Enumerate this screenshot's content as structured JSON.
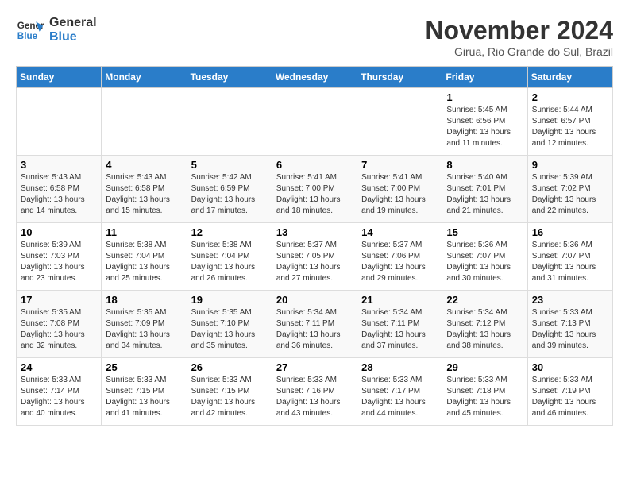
{
  "header": {
    "logo_line1": "General",
    "logo_line2": "Blue",
    "month": "November 2024",
    "location": "Girua, Rio Grande do Sul, Brazil"
  },
  "days_of_week": [
    "Sunday",
    "Monday",
    "Tuesday",
    "Wednesday",
    "Thursday",
    "Friday",
    "Saturday"
  ],
  "weeks": [
    [
      {
        "day": "",
        "info": ""
      },
      {
        "day": "",
        "info": ""
      },
      {
        "day": "",
        "info": ""
      },
      {
        "day": "",
        "info": ""
      },
      {
        "day": "",
        "info": ""
      },
      {
        "day": "1",
        "info": "Sunrise: 5:45 AM\nSunset: 6:56 PM\nDaylight: 13 hours and 11 minutes."
      },
      {
        "day": "2",
        "info": "Sunrise: 5:44 AM\nSunset: 6:57 PM\nDaylight: 13 hours and 12 minutes."
      }
    ],
    [
      {
        "day": "3",
        "info": "Sunrise: 5:43 AM\nSunset: 6:58 PM\nDaylight: 13 hours and 14 minutes."
      },
      {
        "day": "4",
        "info": "Sunrise: 5:43 AM\nSunset: 6:58 PM\nDaylight: 13 hours and 15 minutes."
      },
      {
        "day": "5",
        "info": "Sunrise: 5:42 AM\nSunset: 6:59 PM\nDaylight: 13 hours and 17 minutes."
      },
      {
        "day": "6",
        "info": "Sunrise: 5:41 AM\nSunset: 7:00 PM\nDaylight: 13 hours and 18 minutes."
      },
      {
        "day": "7",
        "info": "Sunrise: 5:41 AM\nSunset: 7:00 PM\nDaylight: 13 hours and 19 minutes."
      },
      {
        "day": "8",
        "info": "Sunrise: 5:40 AM\nSunset: 7:01 PM\nDaylight: 13 hours and 21 minutes."
      },
      {
        "day": "9",
        "info": "Sunrise: 5:39 AM\nSunset: 7:02 PM\nDaylight: 13 hours and 22 minutes."
      }
    ],
    [
      {
        "day": "10",
        "info": "Sunrise: 5:39 AM\nSunset: 7:03 PM\nDaylight: 13 hours and 23 minutes."
      },
      {
        "day": "11",
        "info": "Sunrise: 5:38 AM\nSunset: 7:04 PM\nDaylight: 13 hours and 25 minutes."
      },
      {
        "day": "12",
        "info": "Sunrise: 5:38 AM\nSunset: 7:04 PM\nDaylight: 13 hours and 26 minutes."
      },
      {
        "day": "13",
        "info": "Sunrise: 5:37 AM\nSunset: 7:05 PM\nDaylight: 13 hours and 27 minutes."
      },
      {
        "day": "14",
        "info": "Sunrise: 5:37 AM\nSunset: 7:06 PM\nDaylight: 13 hours and 29 minutes."
      },
      {
        "day": "15",
        "info": "Sunrise: 5:36 AM\nSunset: 7:07 PM\nDaylight: 13 hours and 30 minutes."
      },
      {
        "day": "16",
        "info": "Sunrise: 5:36 AM\nSunset: 7:07 PM\nDaylight: 13 hours and 31 minutes."
      }
    ],
    [
      {
        "day": "17",
        "info": "Sunrise: 5:35 AM\nSunset: 7:08 PM\nDaylight: 13 hours and 32 minutes."
      },
      {
        "day": "18",
        "info": "Sunrise: 5:35 AM\nSunset: 7:09 PM\nDaylight: 13 hours and 34 minutes."
      },
      {
        "day": "19",
        "info": "Sunrise: 5:35 AM\nSunset: 7:10 PM\nDaylight: 13 hours and 35 minutes."
      },
      {
        "day": "20",
        "info": "Sunrise: 5:34 AM\nSunset: 7:11 PM\nDaylight: 13 hours and 36 minutes."
      },
      {
        "day": "21",
        "info": "Sunrise: 5:34 AM\nSunset: 7:11 PM\nDaylight: 13 hours and 37 minutes."
      },
      {
        "day": "22",
        "info": "Sunrise: 5:34 AM\nSunset: 7:12 PM\nDaylight: 13 hours and 38 minutes."
      },
      {
        "day": "23",
        "info": "Sunrise: 5:33 AM\nSunset: 7:13 PM\nDaylight: 13 hours and 39 minutes."
      }
    ],
    [
      {
        "day": "24",
        "info": "Sunrise: 5:33 AM\nSunset: 7:14 PM\nDaylight: 13 hours and 40 minutes."
      },
      {
        "day": "25",
        "info": "Sunrise: 5:33 AM\nSunset: 7:15 PM\nDaylight: 13 hours and 41 minutes."
      },
      {
        "day": "26",
        "info": "Sunrise: 5:33 AM\nSunset: 7:15 PM\nDaylight: 13 hours and 42 minutes."
      },
      {
        "day": "27",
        "info": "Sunrise: 5:33 AM\nSunset: 7:16 PM\nDaylight: 13 hours and 43 minutes."
      },
      {
        "day": "28",
        "info": "Sunrise: 5:33 AM\nSunset: 7:17 PM\nDaylight: 13 hours and 44 minutes."
      },
      {
        "day": "29",
        "info": "Sunrise: 5:33 AM\nSunset: 7:18 PM\nDaylight: 13 hours and 45 minutes."
      },
      {
        "day": "30",
        "info": "Sunrise: 5:33 AM\nSunset: 7:19 PM\nDaylight: 13 hours and 46 minutes."
      }
    ]
  ]
}
